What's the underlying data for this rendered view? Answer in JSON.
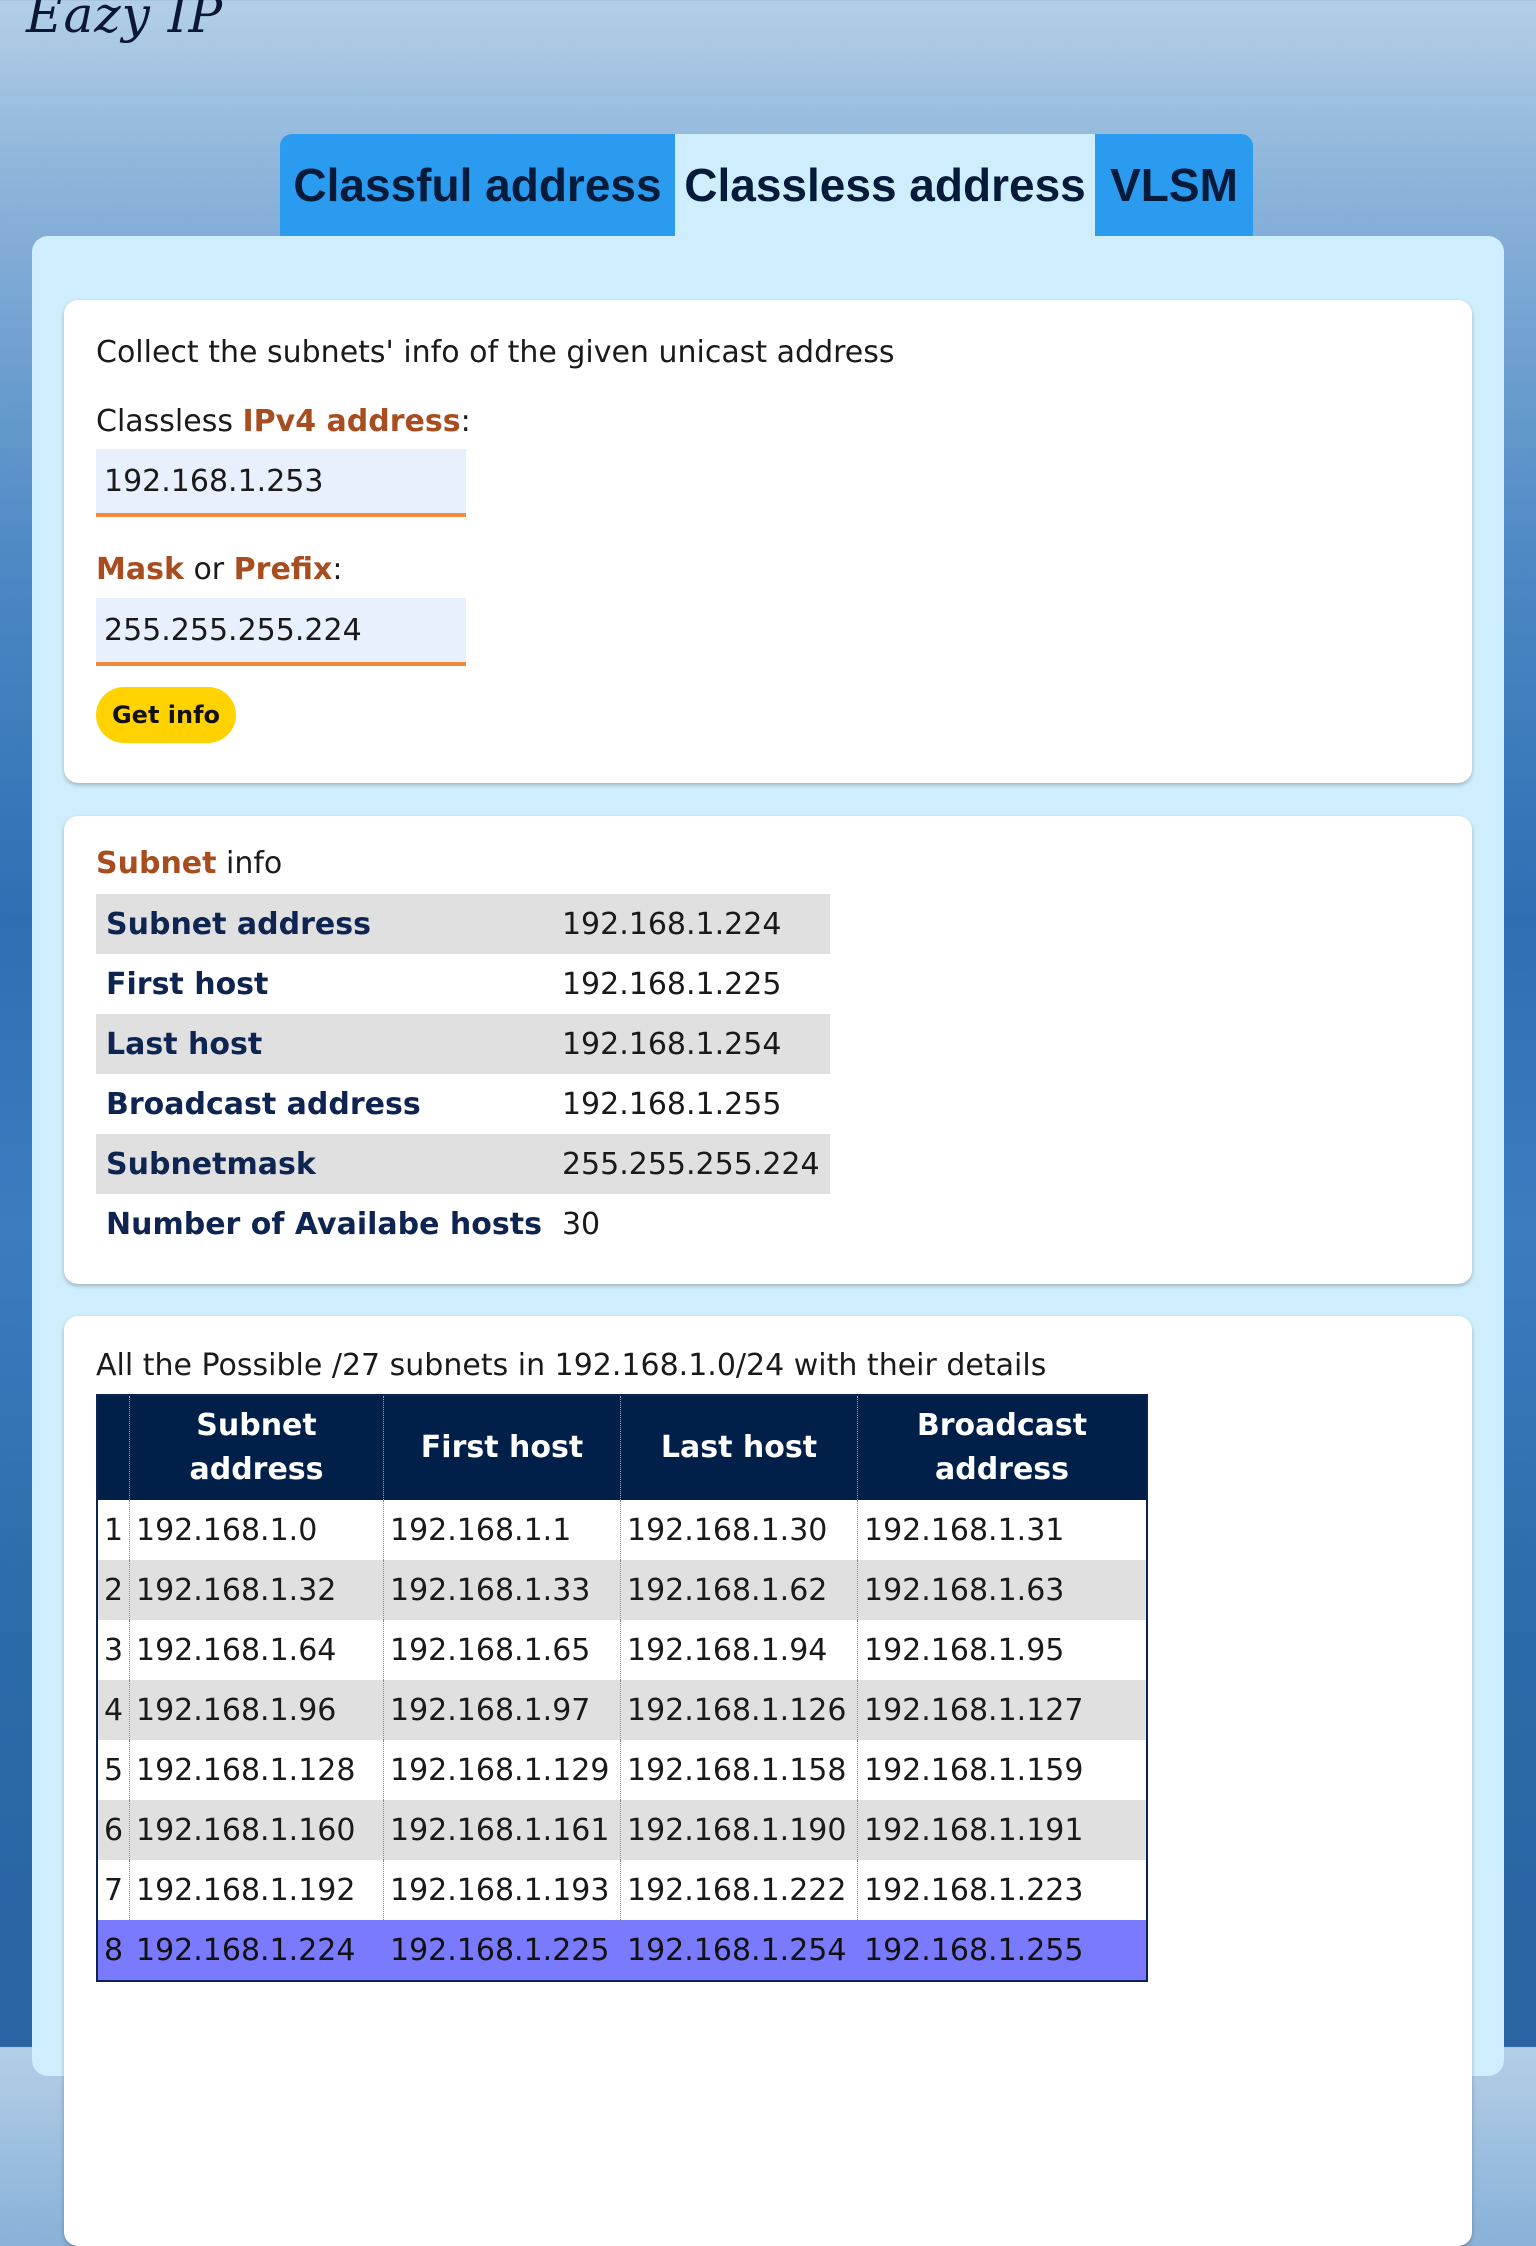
{
  "app": {
    "logo": "Eazy IP"
  },
  "tabs": [
    {
      "label": "Classful address",
      "active": false
    },
    {
      "label": "Classless address",
      "active": true
    },
    {
      "label": "VLSM",
      "active": false
    }
  ],
  "form": {
    "intro": "Collect the subnets' info of the given unicast address",
    "ip_label_prefix": "Classless ",
    "ip_label_accent": "IPv4 address",
    "ip_value": "192.168.1.253",
    "mask_label_accent1": "Mask",
    "mask_label_or": " or ",
    "mask_label_accent2": "Prefix",
    "mask_value": "255.255.255.224",
    "submit_label": "Get info"
  },
  "subnet_info": {
    "title_accent": "Subnet",
    "title_rest": " info",
    "rows": [
      {
        "key": "Subnet address",
        "value": "192.168.1.224"
      },
      {
        "key": "First host",
        "value": "192.168.1.225"
      },
      {
        "key": "Last host",
        "value": "192.168.1.254"
      },
      {
        "key": "Broadcast address",
        "value": "192.168.1.255"
      },
      {
        "key": "Subnetmask",
        "value": "255.255.255.224"
      },
      {
        "key": "Number of Availabe hosts",
        "value": "30"
      }
    ]
  },
  "subnets_table": {
    "title": "All the Possible /27 subnets in 192.168.1.0/24 with their details",
    "headers": [
      "",
      "Subnet address",
      "First host",
      "Last host",
      "Broadcast address"
    ],
    "rows": [
      [
        "1",
        "192.168.1.0",
        "192.168.1.1",
        "192.168.1.30",
        "192.168.1.31"
      ],
      [
        "2",
        "192.168.1.32",
        "192.168.1.33",
        "192.168.1.62",
        "192.168.1.63"
      ],
      [
        "3",
        "192.168.1.64",
        "192.168.1.65",
        "192.168.1.94",
        "192.168.1.95"
      ],
      [
        "4",
        "192.168.1.96",
        "192.168.1.97",
        "192.168.1.126",
        "192.168.1.127"
      ],
      [
        "5",
        "192.168.1.128",
        "192.168.1.129",
        "192.168.1.158",
        "192.168.1.159"
      ],
      [
        "6",
        "192.168.1.160",
        "192.168.1.161",
        "192.168.1.190",
        "192.168.1.191"
      ],
      [
        "7",
        "192.168.1.192",
        "192.168.1.193",
        "192.168.1.222",
        "192.168.1.223"
      ],
      [
        "8",
        "192.168.1.224",
        "192.168.1.225",
        "192.168.1.254",
        "192.168.1.255"
      ]
    ],
    "highlighted_row": 8
  },
  "colors": {
    "tab_inactive": "#2b9bf0",
    "tab_active": "#cfeefd",
    "accent_text": "#a84d1f",
    "button": "#ffd200",
    "table_header": "#00204a",
    "highlight_row": "#7a7aff",
    "input_underline": "#f08a3e"
  }
}
